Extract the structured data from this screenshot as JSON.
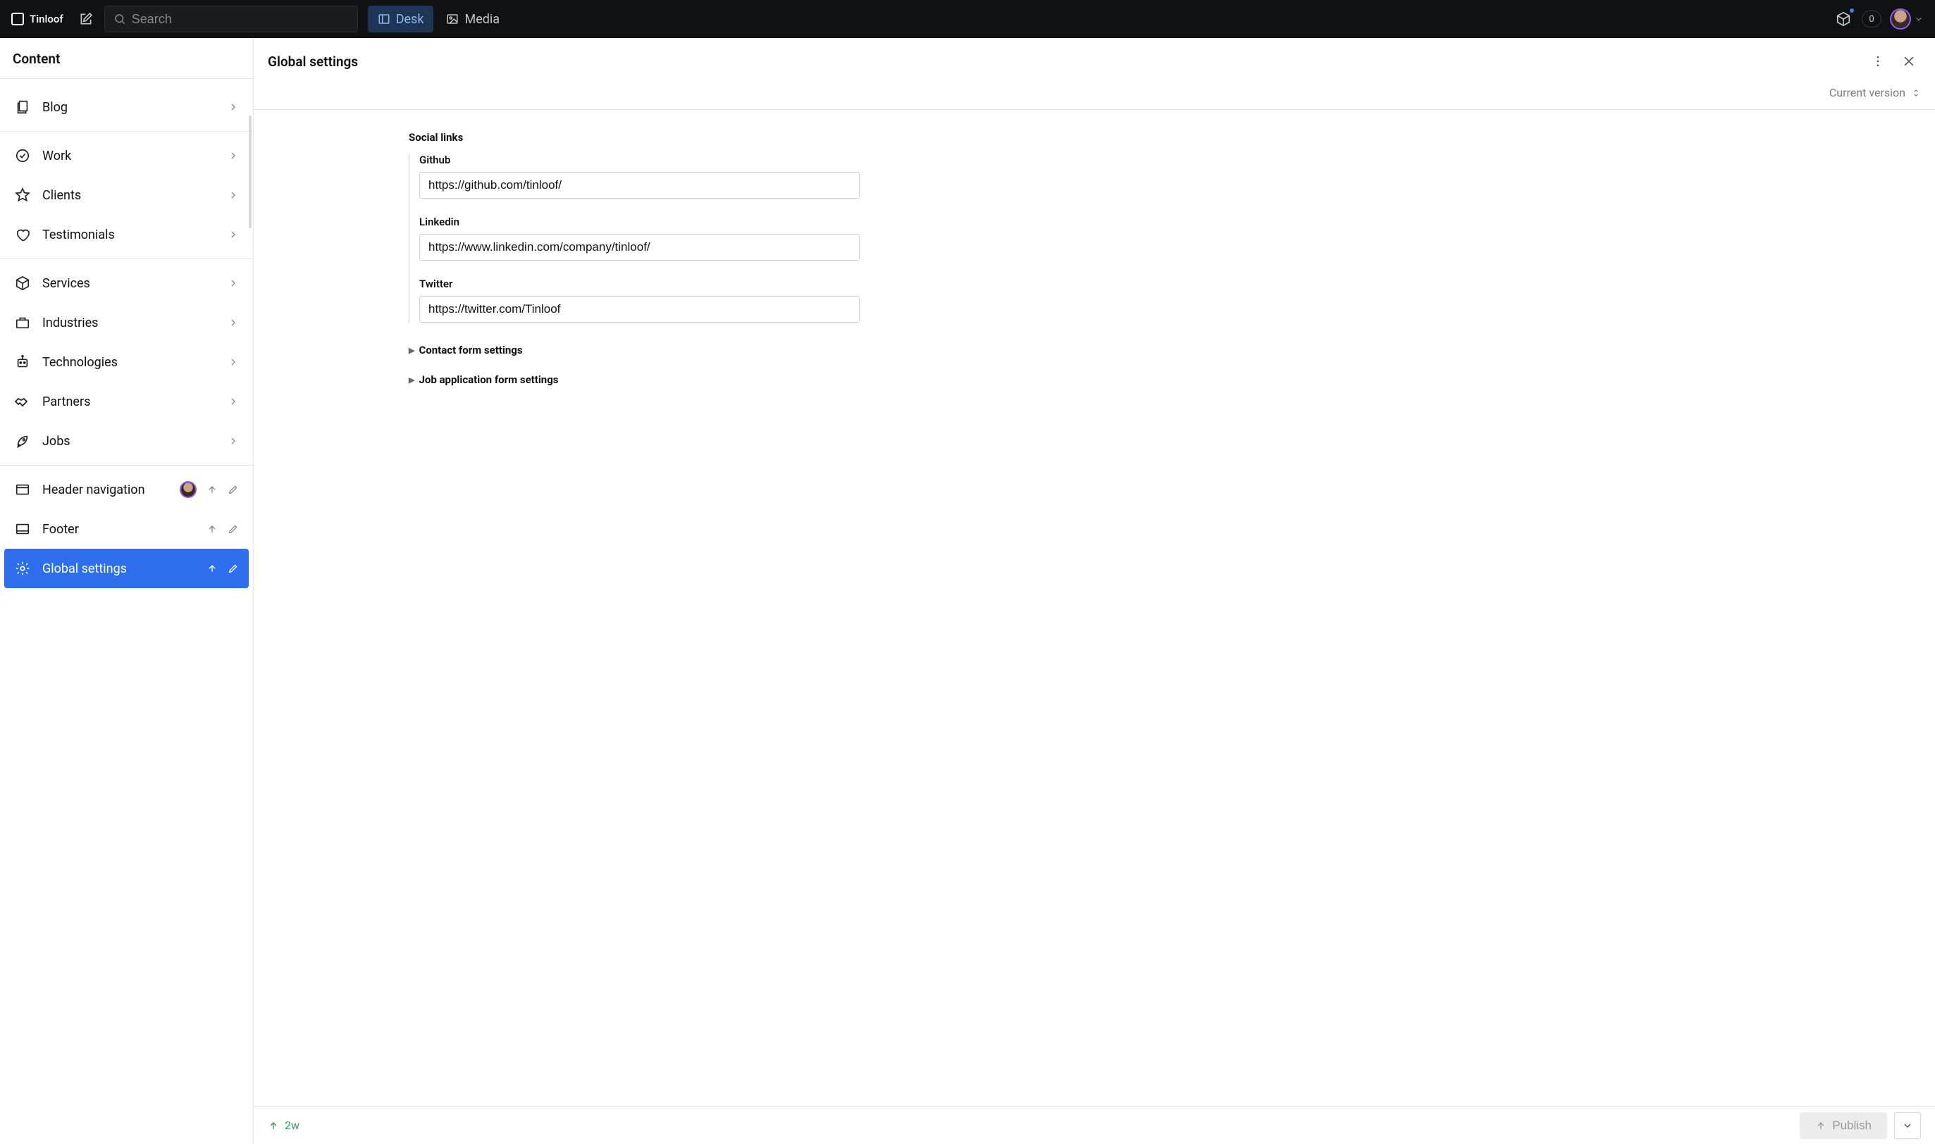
{
  "topbar": {
    "brand": "Tinloof",
    "search_placeholder": "Search",
    "tabs": {
      "desk": "Desk",
      "media": "Media"
    },
    "notif_count": "0"
  },
  "sidebar": {
    "title": "Content",
    "groups": [
      [
        {
          "label": "Blog",
          "icon": "documents",
          "chevron": true
        }
      ],
      [
        {
          "label": "Work",
          "icon": "check",
          "chevron": true
        },
        {
          "label": "Clients",
          "icon": "star",
          "chevron": true
        },
        {
          "label": "Testimonials",
          "icon": "heart",
          "chevron": true
        }
      ],
      [
        {
          "label": "Services",
          "icon": "cube",
          "chevron": true
        },
        {
          "label": "Industries",
          "icon": "briefcase",
          "chevron": true
        },
        {
          "label": "Technologies",
          "icon": "robot",
          "chevron": true
        },
        {
          "label": "Partners",
          "icon": "handshake",
          "chevron": true
        },
        {
          "label": "Jobs",
          "icon": "rocket",
          "chevron": true
        }
      ],
      [
        {
          "label": "Header navigation",
          "icon": "layout-top",
          "avatar": true,
          "publish": true,
          "edit": true
        },
        {
          "label": "Footer",
          "icon": "layout-bottom",
          "publish": true,
          "edit": true
        },
        {
          "label": "Global settings",
          "icon": "gear",
          "publish": true,
          "edit": true,
          "active": true
        }
      ]
    ]
  },
  "panel": {
    "title": "Global settings",
    "version_label": "Current version",
    "social": {
      "section_label": "Social links",
      "github_label": "Github",
      "github_value": "https://github.com/tinloof/",
      "linkedin_label": "Linkedin",
      "linkedin_value": "https://www.linkedin.com/company/tinloof/",
      "twitter_label": "Twitter",
      "twitter_value": "https://twitter.com/Tinloof"
    },
    "disclosures": {
      "contact": "Contact form settings",
      "job": "Job application form settings"
    },
    "footer": {
      "status_age": "2w",
      "publish_label": "Publish"
    }
  }
}
